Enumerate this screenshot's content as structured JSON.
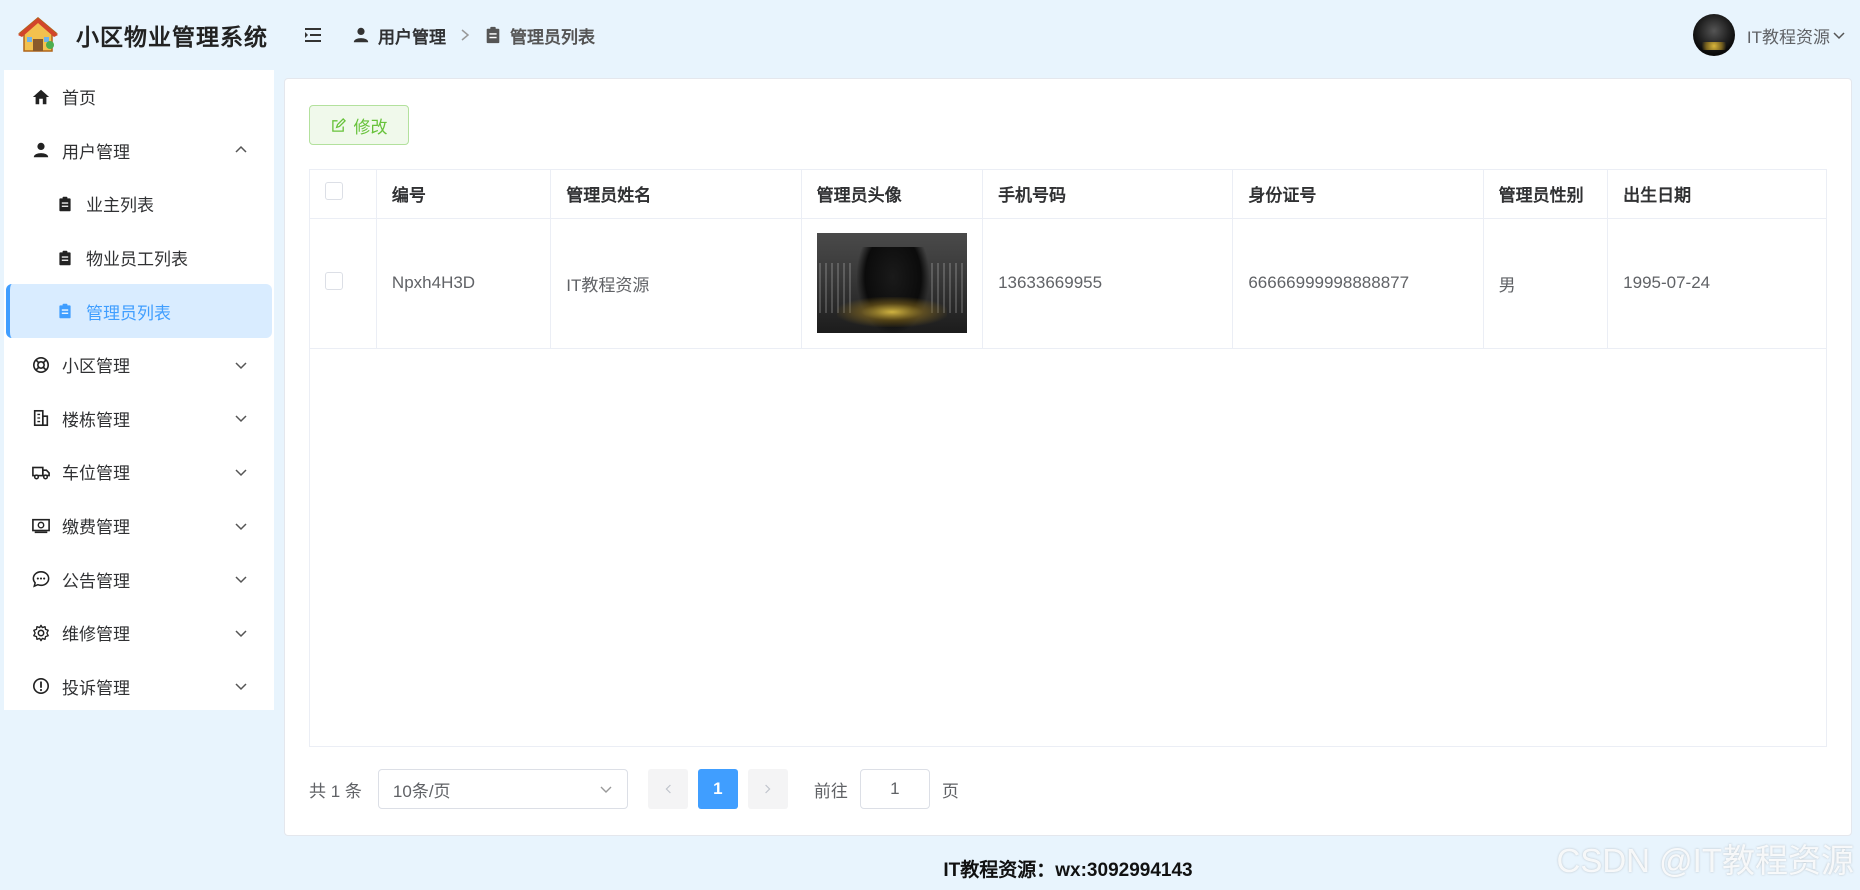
{
  "app": {
    "title": "小区物业管理系统"
  },
  "sidebar": {
    "items": [
      {
        "label": "首页",
        "icon": "home-icon"
      },
      {
        "label": "用户管理",
        "icon": "user-icon",
        "expanded": true,
        "children": [
          {
            "label": "业主列表",
            "icon": "clipboard-icon"
          },
          {
            "label": "物业员工列表",
            "icon": "clipboard-icon"
          },
          {
            "label": "管理员列表",
            "icon": "clipboard-icon",
            "active": true
          }
        ]
      },
      {
        "label": "小区管理",
        "icon": "lifebuoy-icon"
      },
      {
        "label": "楼栋管理",
        "icon": "building-icon"
      },
      {
        "label": "车位管理",
        "icon": "truck-icon"
      },
      {
        "label": "缴费管理",
        "icon": "payment-icon"
      },
      {
        "label": "公告管理",
        "icon": "chat-icon"
      },
      {
        "label": "维修管理",
        "icon": "gear-icon"
      },
      {
        "label": "投诉管理",
        "icon": "warning-icon"
      }
    ]
  },
  "header": {
    "breadcrumb": [
      {
        "label": "用户管理",
        "icon": "user-icon"
      },
      {
        "label": "管理员列表",
        "icon": "clipboard-icon"
      }
    ],
    "user_name": "IT教程资源"
  },
  "toolbar": {
    "edit_label": "修改"
  },
  "table": {
    "columns": [
      "编号",
      "管理员姓名",
      "管理员头像",
      "手机号码",
      "身份证号",
      "管理员性别",
      "出生日期"
    ],
    "rows": [
      {
        "id": "Npxh4H3D",
        "name": "IT教程资源",
        "phone": "13633669955",
        "id_card": "66666999998888877",
        "gender": "男",
        "birthday": "1995-07-24"
      }
    ]
  },
  "pagination": {
    "total_text": "共 1 条",
    "page_size": "10条/页",
    "current_page": "1",
    "goto_label": "前往",
    "goto_value": "1",
    "page_unit": "页"
  },
  "footer": {
    "text": "IT教程资源：wx:3092994143"
  },
  "watermark": "CSDN @IT教程资源",
  "colors": {
    "accent": "#409eff",
    "success": "#67c23a",
    "background": "#e8f4fd"
  }
}
